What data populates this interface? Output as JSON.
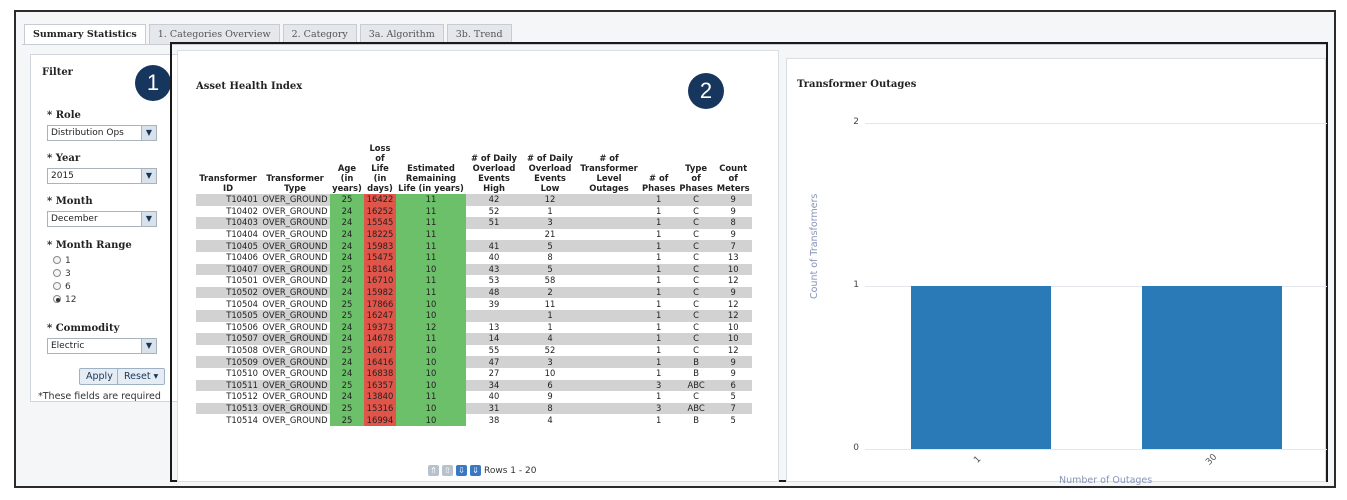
{
  "tabs": [
    {
      "label": "Summary Statistics",
      "active": true
    },
    {
      "label": "1. Categories Overview",
      "active": false
    },
    {
      "label": "2. Category",
      "active": false
    },
    {
      "label": "3a. Algorithm",
      "active": false
    },
    {
      "label": "3b. Trend",
      "active": false
    }
  ],
  "filter": {
    "title": "Filter",
    "badge": "1",
    "role_label": "* Role",
    "role_value": "Distribution Ops",
    "year_label": "* Year",
    "year_value": "2015",
    "month_label": "* Month",
    "month_value": "December",
    "range_label": "* Month Range",
    "range_options": [
      "1",
      "3",
      "6",
      "12"
    ],
    "range_selected": "12",
    "commodity_label": "* Commodity",
    "commodity_value": "Electric",
    "apply_label": "Apply",
    "reset_label": "Reset ▾",
    "required_note": "*These fields are required"
  },
  "asset": {
    "title": "Asset Health Index",
    "badge": "2",
    "columns": [
      "Transformer ID",
      "Transformer Type",
      "Age (in years)",
      "Loss of Life (in days)",
      "Estimated Remaining Life (in years)",
      "# of Daily Overload Events High",
      "# of Daily Overload Events Low",
      "# of Transformer Level Outages",
      "# of Phases",
      "Type of Phases",
      "Count of Meters"
    ],
    "rows": [
      [
        "T10401",
        "OVER_GROUND",
        "25",
        "16422",
        "11",
        "42",
        "12",
        "",
        "1",
        "C",
        "9"
      ],
      [
        "T10402",
        "OVER_GROUND",
        "24",
        "16252",
        "11",
        "52",
        "1",
        "",
        "1",
        "C",
        "9"
      ],
      [
        "T10403",
        "OVER_GROUND",
        "24",
        "15545",
        "11",
        "51",
        "3",
        "",
        "1",
        "C",
        "8"
      ],
      [
        "T10404",
        "OVER_GROUND",
        "24",
        "18225",
        "11",
        "",
        "21",
        "",
        "1",
        "C",
        "9"
      ],
      [
        "T10405",
        "OVER_GROUND",
        "24",
        "15983",
        "11",
        "41",
        "5",
        "",
        "1",
        "C",
        "7"
      ],
      [
        "T10406",
        "OVER_GROUND",
        "24",
        "15475",
        "11",
        "40",
        "8",
        "",
        "1",
        "C",
        "13"
      ],
      [
        "T10407",
        "OVER_GROUND",
        "25",
        "18164",
        "10",
        "43",
        "5",
        "",
        "1",
        "C",
        "10"
      ],
      [
        "T10501",
        "OVER_GROUND",
        "24",
        "16710",
        "11",
        "53",
        "58",
        "",
        "1",
        "C",
        "12"
      ],
      [
        "T10502",
        "OVER_GROUND",
        "24",
        "15982",
        "11",
        "48",
        "2",
        "",
        "1",
        "C",
        "9"
      ],
      [
        "T10504",
        "OVER_GROUND",
        "25",
        "17866",
        "10",
        "39",
        "11",
        "",
        "1",
        "C",
        "12"
      ],
      [
        "T10505",
        "OVER_GROUND",
        "25",
        "16247",
        "10",
        "",
        "1",
        "",
        "1",
        "C",
        "12"
      ],
      [
        "T10506",
        "OVER_GROUND",
        "24",
        "19373",
        "12",
        "13",
        "1",
        "",
        "1",
        "C",
        "10"
      ],
      [
        "T10507",
        "OVER_GROUND",
        "24",
        "14678",
        "11",
        "14",
        "4",
        "",
        "1",
        "C",
        "10"
      ],
      [
        "T10508",
        "OVER_GROUND",
        "25",
        "16617",
        "10",
        "55",
        "52",
        "",
        "1",
        "C",
        "12"
      ],
      [
        "T10509",
        "OVER_GROUND",
        "24",
        "16416",
        "10",
        "47",
        "3",
        "",
        "1",
        "B",
        "9"
      ],
      [
        "T10510",
        "OVER_GROUND",
        "24",
        "16838",
        "10",
        "27",
        "10",
        "",
        "1",
        "B",
        "9"
      ],
      [
        "T10511",
        "OVER_GROUND",
        "25",
        "16357",
        "10",
        "34",
        "6",
        "",
        "3",
        "ABC",
        "6"
      ],
      [
        "T10512",
        "OVER_GROUND",
        "24",
        "13840",
        "11",
        "40",
        "9",
        "",
        "1",
        "C",
        "5"
      ],
      [
        "T10513",
        "OVER_GROUND",
        "25",
        "15316",
        "10",
        "31",
        "8",
        "",
        "3",
        "ABC",
        "7"
      ],
      [
        "T10514",
        "OVER_GROUND",
        "25",
        "16994",
        "10",
        "38",
        "4",
        "",
        "1",
        "B",
        "5"
      ]
    ],
    "pager_text": "Rows 1 - 20"
  },
  "outages": {
    "title": "Transformer Outages",
    "chart_data": {
      "type": "bar",
      "categories": [
        "1",
        "30"
      ],
      "values": [
        1,
        1
      ],
      "ylabel": "Count of Transformers",
      "xlabel": "Number of Outages",
      "ylim": [
        0,
        2
      ],
      "yticks": [
        "0",
        "1",
        "2"
      ],
      "grid": true,
      "bar_color": "#2a7ab7"
    }
  }
}
